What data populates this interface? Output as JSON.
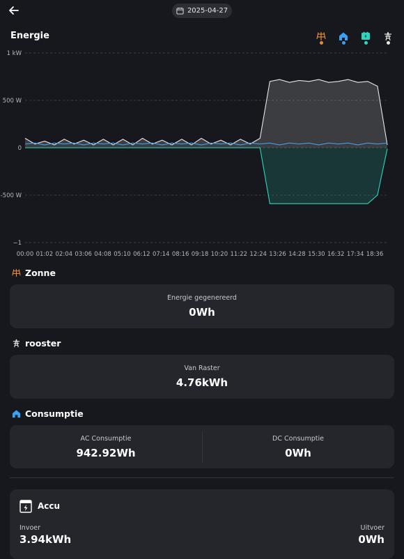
{
  "header": {
    "date": "2025-04-27"
  },
  "energie": {
    "title": "Energie"
  },
  "legend": [
    {
      "name": "zonne",
      "color": "#e38a3c"
    },
    {
      "name": "consumptie",
      "color": "#3aa0f0"
    },
    {
      "name": "accu",
      "color": "#2ad8c0"
    },
    {
      "name": "rooster",
      "color": "#e6e6e6"
    }
  ],
  "chart_data": {
    "type": "line",
    "y_ticks": [
      "1 kW",
      "500 W",
      "0",
      "-500 W",
      "−1"
    ],
    "ylim": [
      -1000,
      1000
    ],
    "x_ticks": [
      "00:00",
      "01:02",
      "02:04",
      "03:06",
      "04:08",
      "05:10",
      "06:12",
      "07:14",
      "08:16",
      "09:18",
      "10:20",
      "11:22",
      "12:24",
      "13:26",
      "14:28",
      "15:30",
      "16:32",
      "17:34",
      "18:36"
    ],
    "grid": true,
    "series": [
      {
        "color": "#e8e8ea",
        "values": [
          100,
          40,
          70,
          30,
          90,
          40,
          80,
          30,
          90,
          30,
          90,
          30,
          100,
          40,
          80,
          30,
          90,
          30,
          100,
          40,
          80,
          30,
          90,
          40,
          100,
          700,
          720,
          690,
          710,
          700,
          720,
          690,
          700,
          720,
          690,
          700,
          650,
          30
        ]
      },
      {
        "color": "#3aa0f0",
        "values": [
          40,
          50,
          30,
          50,
          40,
          50,
          30,
          50,
          40,
          50,
          30,
          50,
          40,
          50,
          30,
          50,
          40,
          50,
          30,
          50,
          40,
          50,
          30,
          50,
          40,
          50,
          30,
          50,
          40,
          50,
          30,
          50,
          40,
          50,
          30,
          50,
          40,
          50
        ]
      },
      {
        "color": "#2ad8c0",
        "values": [
          0,
          0,
          0,
          0,
          0,
          0,
          0,
          0,
          0,
          0,
          0,
          0,
          0,
          0,
          0,
          0,
          0,
          0,
          0,
          0,
          0,
          0,
          0,
          0,
          0,
          -590,
          -590,
          -590,
          -590,
          -590,
          -590,
          -590,
          -590,
          -590,
          -590,
          -590,
          -500,
          -10
        ]
      }
    ]
  },
  "zonne": {
    "title": "Zonne",
    "label": "Energie gegenereerd",
    "value": "0Wh"
  },
  "rooster": {
    "title": "rooster",
    "label": "Van Raster",
    "value": "4.76kWh"
  },
  "consumptie": {
    "title": "Consumptie",
    "ac_label": "AC Consumptie",
    "ac_value": "942.92Wh",
    "dc_label": "DC Consumptie",
    "dc_value": "0Wh"
  },
  "accu": {
    "title": "Accu",
    "invoer_label": "Invoer",
    "invoer_value": "3.94kWh",
    "uitvoer_label": "Uitvoer",
    "uitvoer_value": "0Wh"
  }
}
